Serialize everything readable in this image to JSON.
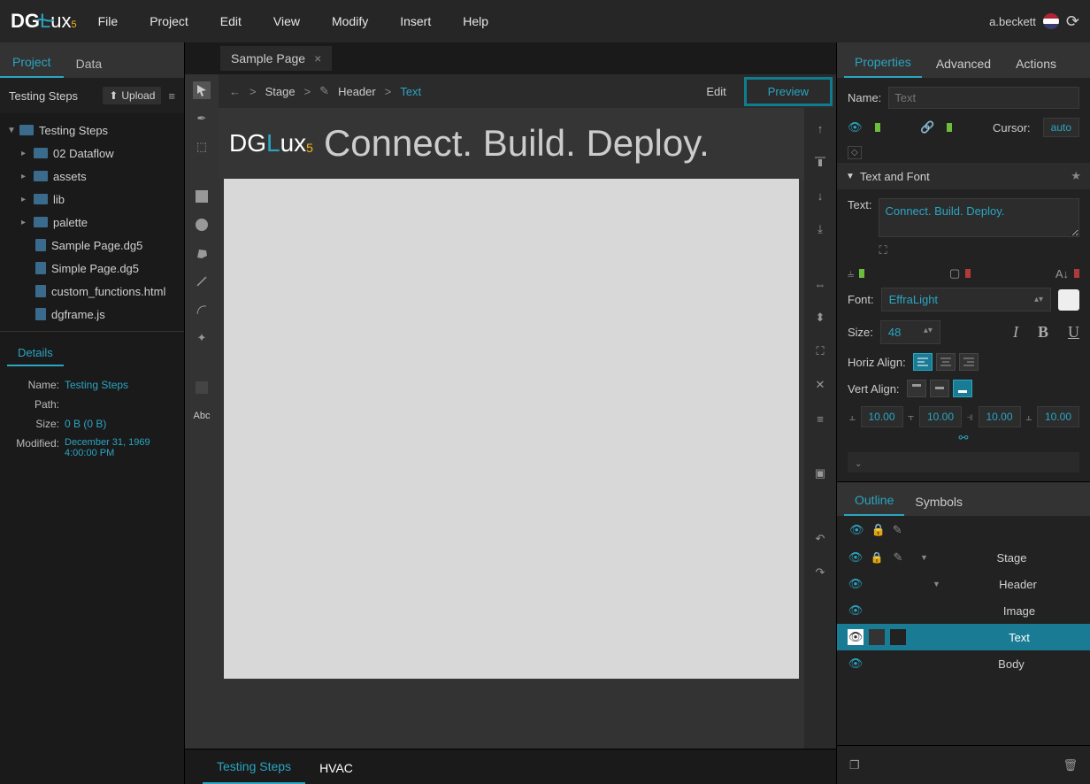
{
  "logo": {
    "main": "DGLux",
    "sub": "5"
  },
  "menubar": {
    "items": [
      "File",
      "Project",
      "Edit",
      "View",
      "Modify",
      "Insert",
      "Help"
    ],
    "user": "a.beckett"
  },
  "left": {
    "tabs": [
      "Project",
      "Data"
    ],
    "active_tab": 0,
    "panel_title": "Testing Steps",
    "upload_label": "Upload",
    "tree": [
      {
        "label": "Testing Steps",
        "type": "folder",
        "expanded": true,
        "depth": 0
      },
      {
        "label": "02 Dataflow",
        "type": "folder",
        "expanded": false,
        "depth": 1
      },
      {
        "label": "assets",
        "type": "folder",
        "expanded": false,
        "depth": 1
      },
      {
        "label": "lib",
        "type": "folder",
        "expanded": false,
        "depth": 1
      },
      {
        "label": "palette",
        "type": "folder",
        "expanded": false,
        "depth": 1
      },
      {
        "label": "Sample Page.dg5",
        "type": "file",
        "depth": 2
      },
      {
        "label": "Simple Page.dg5",
        "type": "file",
        "depth": 2
      },
      {
        "label": "custom_functions.html",
        "type": "file",
        "depth": 2
      },
      {
        "label": "dgframe.js",
        "type": "file",
        "depth": 2
      }
    ],
    "details": {
      "header": "Details",
      "rows": {
        "name_label": "Name:",
        "name": "Testing Steps",
        "path_label": "Path:",
        "path": "",
        "size_label": "Size:",
        "size": "0 B (0 B)",
        "modified_label": "Modified:",
        "modified": "December 31, 1969 4:00:00 PM"
      }
    }
  },
  "center": {
    "doc_tab": "Sample Page",
    "crumbs": {
      "stage": "Stage",
      "header": "Header",
      "text": "Text"
    },
    "edit_label": "Edit",
    "preview_label": "Preview",
    "stage": {
      "logo": "DGLux",
      "logo_sub": "5",
      "tagline": "Connect. Build. Deploy."
    },
    "tool_abc": "Abc"
  },
  "bottom": {
    "tabs": [
      "Testing Steps",
      "HVAC"
    ],
    "active": 0
  },
  "props": {
    "tabs": [
      "Properties",
      "Advanced",
      "Actions"
    ],
    "name_label": "Name:",
    "name_placeholder": "Text",
    "cursor_label": "Cursor:",
    "cursor_value": "auto",
    "section_text": "Text and Font",
    "text_label": "Text:",
    "text_value": "Connect. Build. Deploy.",
    "font_label": "Font:",
    "font_value": "EffraLight",
    "size_label": "Size:",
    "size_value": "48",
    "horiz_label": "Horiz Align:",
    "vert_label": "Vert Align:",
    "padding_values": [
      "10.00",
      "10.00",
      "10.00",
      "10.00"
    ]
  },
  "outline": {
    "tabs": [
      "Outline",
      "Symbols"
    ],
    "rows": [
      "Stage",
      "Header",
      "Image",
      "Text",
      "Body"
    ],
    "selected": 3
  }
}
